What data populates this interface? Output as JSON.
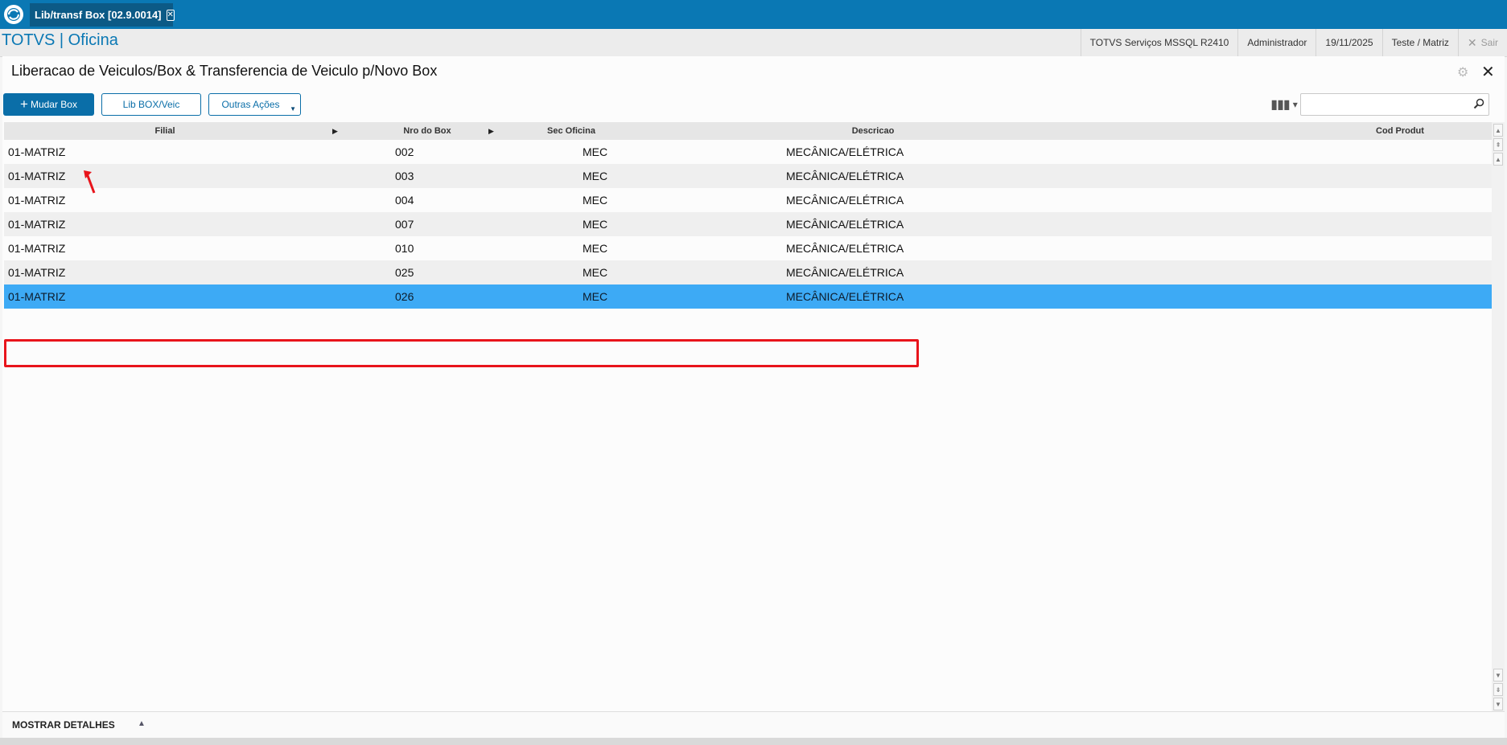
{
  "app": {
    "tab_label": "Lib/transf Box [02.9.0014]",
    "brand": "TOTVS | Oficina"
  },
  "header": {
    "environment": "TOTVS Serviços MSSQL R2410",
    "user": "Administrador",
    "date": "19/11/2025",
    "branch": "Teste / Matriz",
    "exit_label": "Sair"
  },
  "page": {
    "title": "Liberacao de Veiculos/Box & Transferencia de Veiculo p/Novo Box"
  },
  "toolbar": {
    "mudar_box": "Mudar Box",
    "lib_box_veic": "Lib BOX/Veic",
    "outras_acoes": "Outras Ações"
  },
  "search": {
    "placeholder": ""
  },
  "grid": {
    "columns": [
      "Filial",
      "Nro do Box",
      "Sec Oficina",
      "Descricao",
      "Cod Produt"
    ],
    "rows": [
      {
        "filial": "01-MATRIZ",
        "box": "002",
        "sec": "MEC",
        "desc": "MECÂNICA/ELÉTRICA",
        "cod": ""
      },
      {
        "filial": "01-MATRIZ",
        "box": "003",
        "sec": "MEC",
        "desc": "MECÂNICA/ELÉTRICA",
        "cod": ""
      },
      {
        "filial": "01-MATRIZ",
        "box": "004",
        "sec": "MEC",
        "desc": "MECÂNICA/ELÉTRICA",
        "cod": ""
      },
      {
        "filial": "01-MATRIZ",
        "box": "007",
        "sec": "MEC",
        "desc": "MECÂNICA/ELÉTRICA",
        "cod": ""
      },
      {
        "filial": "01-MATRIZ",
        "box": "010",
        "sec": "MEC",
        "desc": "MECÂNICA/ELÉTRICA",
        "cod": ""
      },
      {
        "filial": "01-MATRIZ",
        "box": "025",
        "sec": "MEC",
        "desc": "MECÂNICA/ELÉTRICA",
        "cod": ""
      },
      {
        "filial": "01-MATRIZ",
        "box": "026",
        "sec": "MEC",
        "desc": "MECÂNICA/ELÉTRICA",
        "cod": ""
      }
    ],
    "selected_row": 6
  },
  "footer": {
    "details_label": "MOSTRAR DETALHES"
  },
  "colors": {
    "brand_blue": "#0a78b4",
    "selected_row": "#3daaf5",
    "annotation_red": "#e8141b"
  }
}
